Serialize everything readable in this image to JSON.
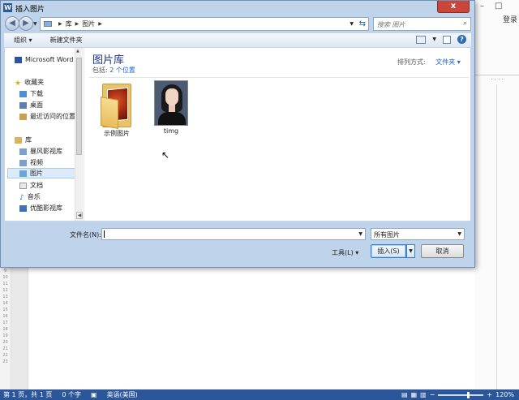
{
  "dialog": {
    "title": "插入图片",
    "title_icon": "W",
    "close_glyph": "x"
  },
  "address": {
    "crumbs": [
      "库",
      "图片"
    ],
    "search_placeholder": "搜索 图片"
  },
  "toolbar": {
    "organize": "组织 ▾",
    "new_folder": "新建文件夹"
  },
  "nav": {
    "items": [
      {
        "label": "Microsoft Word"
      },
      {
        "label": "收藏夹"
      },
      {
        "label": "下载"
      },
      {
        "label": "桌面"
      },
      {
        "label": "最近访问的位置"
      },
      {
        "label": "库"
      },
      {
        "label": "暴风影视库"
      },
      {
        "label": "视频"
      },
      {
        "label": "图片"
      },
      {
        "label": "文档"
      },
      {
        "label": "音乐"
      },
      {
        "label": "优酷影视库"
      }
    ]
  },
  "library": {
    "title": "图片库",
    "includes_label": "包括:",
    "includes_link": "2 个位置",
    "arrange_label": "排列方式:",
    "arrange_value": "文件夹 ▾"
  },
  "files": [
    {
      "name": "示例图片"
    },
    {
      "name": "timg"
    }
  ],
  "bottom": {
    "filename_label": "文件名(N):",
    "filename_value": "",
    "filetype_value": "所有图片",
    "tools_label": "工具(L)  ▾",
    "insert_label": "插入(S)",
    "cancel_label": "取消"
  },
  "word": {
    "login_label": "登录",
    "ruler_numbers": [
      "9",
      "10",
      "11",
      "12",
      "13",
      "14",
      "15",
      "16",
      "17",
      "18",
      "19",
      "20",
      "21",
      "22",
      "23"
    ]
  },
  "status": {
    "page": "第 1 页，共 1 页",
    "words": "0 个字",
    "language": "英语(美国)",
    "zoom": "120%",
    "zoom_level_percent": 120
  }
}
